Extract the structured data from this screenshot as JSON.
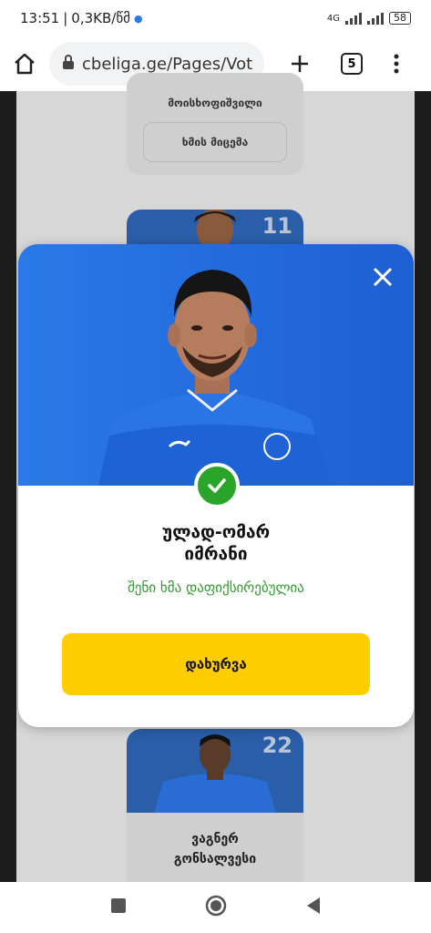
{
  "status_bar": {
    "time": "13:51",
    "data_speed": "0,3KB/წმ",
    "network": "4G",
    "battery": "58"
  },
  "browser": {
    "url": "cbeliga.ge/Pages/Vot",
    "tab_count": "5"
  },
  "background_cards": {
    "card1_name": "მოისხოფიშვილი",
    "card1_vote_label": "ხმის მიცემა",
    "card2_number": "11",
    "card3_number": "22",
    "card3_name_line1": "ვაგნერ",
    "card3_name_line2": "გონსალვესი"
  },
  "modal": {
    "player_name_line1": "ულად-ომარ",
    "player_name_line2": "იმრანი",
    "confirmation": "შენი ხმა დაფიქსირებულია",
    "close_label": "დახურვა",
    "photo_bg": "#1f6fe0",
    "check_color": "#2aa52a",
    "button_color": "#ffcd00"
  }
}
